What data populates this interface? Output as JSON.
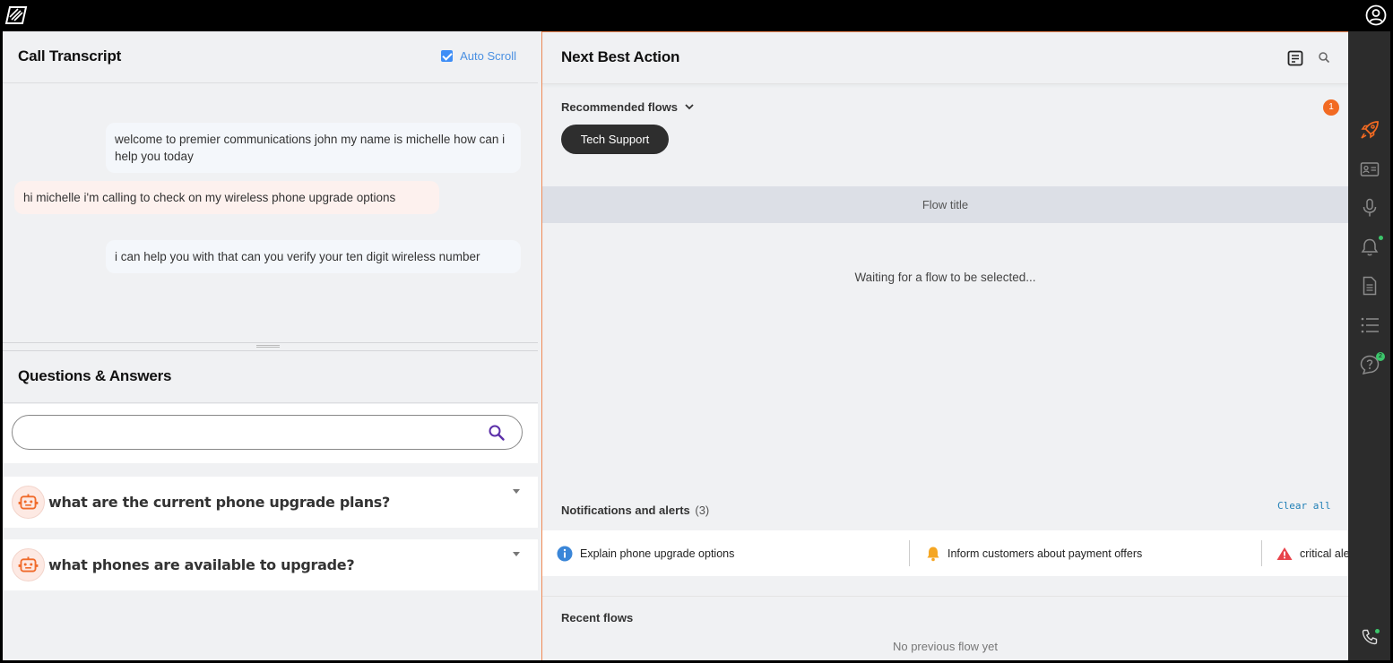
{
  "transcript": {
    "title": "Call Transcript",
    "auto_scroll_label": "Auto Scroll",
    "messages": [
      {
        "speaker": "agent",
        "text": "welcome to premier communications john my name is michelle how can i help you today"
      },
      {
        "speaker": "customer",
        "text": "hi michelle i'm calling to check on my wireless phone upgrade options"
      },
      {
        "speaker": "agent",
        "text": "i can help you with that can you verify your ten digit wireless number"
      }
    ]
  },
  "qa": {
    "title": "Questions & Answers",
    "search_placeholder": "",
    "items": [
      {
        "question": "what are the current phone upgrade plans?"
      },
      {
        "question": "what phones are available to upgrade?"
      }
    ]
  },
  "nba": {
    "title": "Next Best Action",
    "recommended_label": "Recommended flows",
    "recommended_count": "1",
    "recommended_flows": [
      "Tech Support"
    ],
    "flow_title": "Flow title",
    "waiting_text": "Waiting for a flow to be selected...",
    "notifications_label": "Notifications and alerts",
    "notifications_count": "(3)",
    "clear_all": "Clear all",
    "notifications": [
      {
        "type": "info",
        "text": "Explain phone upgrade options"
      },
      {
        "type": "warning",
        "text": "Inform customers about payment offers"
      },
      {
        "type": "critical",
        "text": "critical ale"
      }
    ],
    "recent_label": "Recent flows",
    "recent_empty": "No previous flow yet"
  },
  "rail": {
    "questions_badge": "2",
    "icons": [
      "rocket-icon",
      "contact-card-icon",
      "microphone-icon",
      "bell-icon",
      "document-icon",
      "list-icon",
      "question-icon",
      "phone-icon"
    ]
  },
  "colors": {
    "accent": "#f26a22",
    "link": "#4a90e2",
    "status_green": "#3cc56b"
  }
}
